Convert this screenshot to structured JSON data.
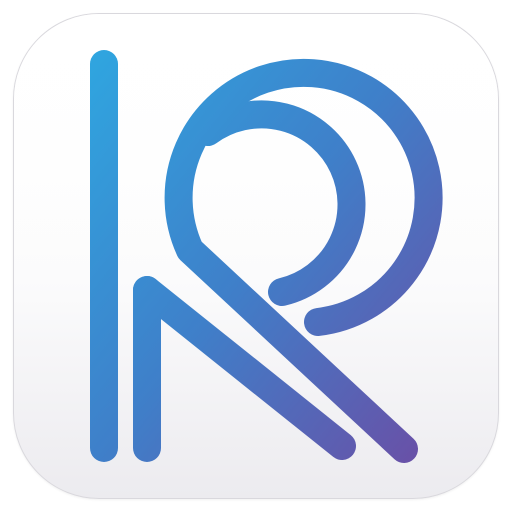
{
  "app_icon": {
    "icon_name": "r-letter-logo-icon",
    "colors": {
      "gradient_start": "#2fa6e0",
      "gradient_mid": "#3f7fc9",
      "gradient_end": "#6a4fa6",
      "tile_background": "#ffffff",
      "tile_border": "#d9d8dd"
    }
  }
}
